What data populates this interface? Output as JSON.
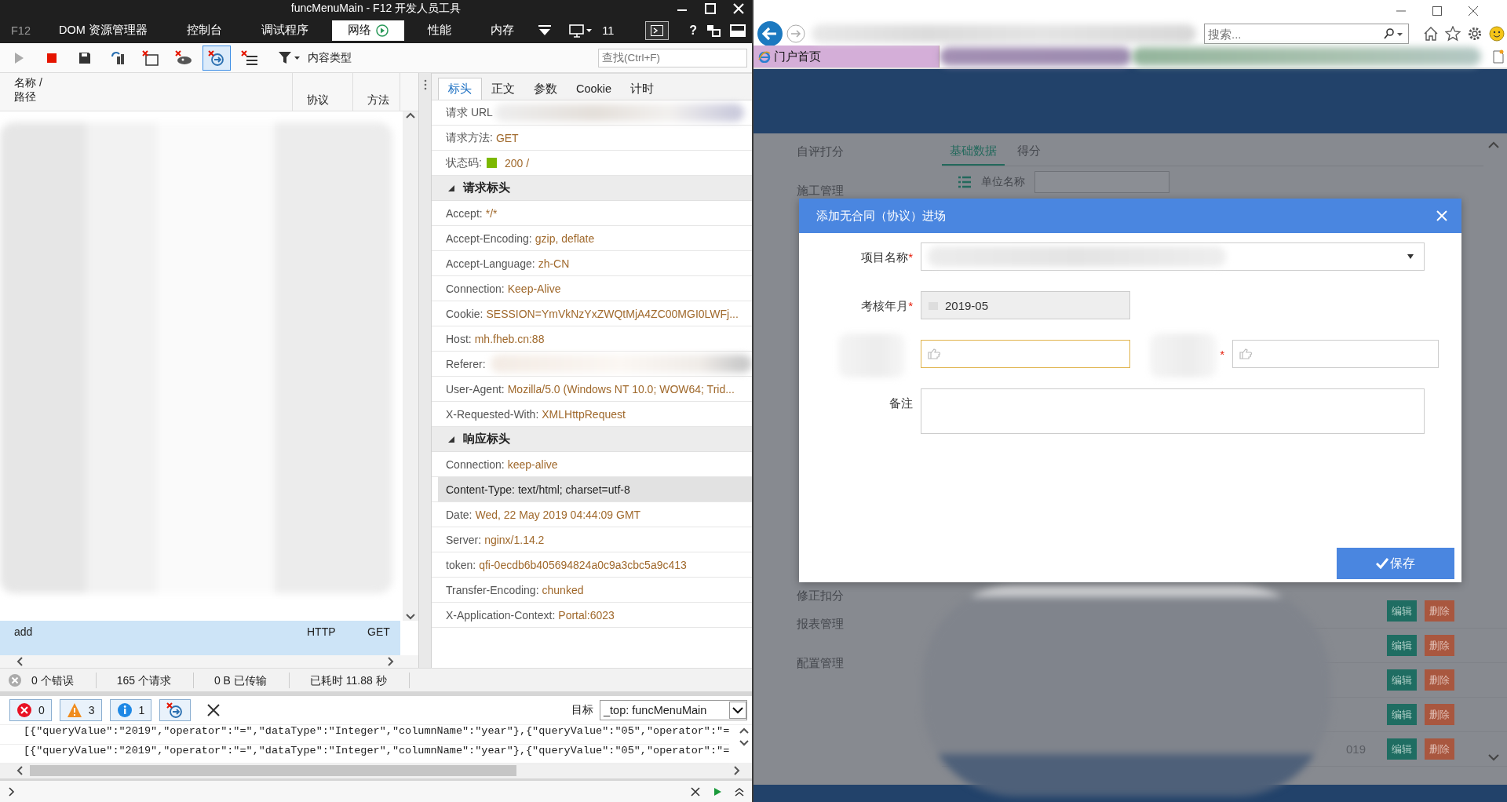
{
  "devtools": {
    "title": "funcMenuMain - F12 开发人员工具",
    "brand": "F12",
    "tabs": [
      {
        "label": "DOM 资源管理器",
        "selected": false
      },
      {
        "label": "控制台",
        "selected": false
      },
      {
        "label": "调试程序",
        "selected": false
      },
      {
        "label": "网络",
        "selected": true
      },
      {
        "label": "性能",
        "selected": false
      },
      {
        "label": "内存",
        "selected": false
      }
    ],
    "document_mode": "11",
    "help": "?",
    "toolbar": {
      "filter_label": "内容类型",
      "search_placeholder": "查找(Ctrl+F)"
    },
    "request_list": {
      "columns": [
        "名称 /\n路径",
        "协议",
        "方法"
      ],
      "rows": [
        {
          "name": "add",
          "protocol": "HTTP",
          "method": "GET",
          "selected": true
        }
      ]
    },
    "detail_tabs": [
      {
        "label": "标头",
        "selected": true
      },
      {
        "label": "正文",
        "selected": false
      },
      {
        "label": "参数",
        "selected": false
      },
      {
        "label": "Cookie",
        "selected": false
      },
      {
        "label": "计时",
        "selected": false
      }
    ],
    "general": [
      {
        "kind": "text",
        "label": "请求 URL"
      },
      {
        "kind": "text",
        "label": "请求方法:",
        "value": "GET"
      },
      {
        "kind": "status",
        "label": "状态码:",
        "value": "200 /"
      }
    ],
    "sections": [
      {
        "title": "请求标头",
        "expanded": true,
        "headers": [
          {
            "name": "Accept:",
            "value": "*/*",
            "selected": false
          },
          {
            "name": "Accept-Encoding:",
            "value": "gzip, deflate",
            "selected": false
          },
          {
            "name": "Accept-Language:",
            "value": "zh-CN",
            "selected": false
          },
          {
            "name": "Connection:",
            "value": "Keep-Alive",
            "selected": false
          },
          {
            "name": "Cookie:",
            "value": "SESSION=YmVkNzYxZWQtMjA4ZC00MGI0LWFj...",
            "selected": false
          },
          {
            "name": "Host:",
            "value": "mh.fheb.cn:88",
            "selected": false
          },
          {
            "name": "Referer:",
            "selected": false
          },
          {
            "name": "User-Agent:",
            "value": "Mozilla/5.0 (Windows NT 10.0; WOW64; Trid...",
            "selected": false
          },
          {
            "name": "X-Requested-With:",
            "value": "XMLHttpRequest",
            "selected": false
          }
        ]
      },
      {
        "title": "响应标头",
        "expanded": true,
        "headers": [
          {
            "name": "Connection:",
            "value": "keep-alive",
            "selected": false
          },
          {
            "name": "Content-Type:",
            "value": "text/html; charset=utf-8",
            "selected": true
          },
          {
            "name": "Date:",
            "value": "Wed, 22 May 2019 04:44:09 GMT",
            "selected": false
          },
          {
            "name": "Server:",
            "value": "nginx/1.14.2",
            "selected": false
          },
          {
            "name": "token:",
            "value": "qfi-0ecdb6b405694824a0c9a3cbc5a9c413",
            "selected": false
          },
          {
            "name": "Transfer-Encoding:",
            "value": "chunked",
            "selected": false
          },
          {
            "name": "X-Application-Context:",
            "value": "Portal:6023",
            "selected": false
          }
        ]
      }
    ],
    "status_bar": [
      "0 个错误",
      "165 个请求",
      "0 B 已传输",
      "已耗时 11.88 秒"
    ],
    "console": {
      "filters": [
        {
          "kind": "error",
          "count": "0"
        },
        {
          "kind": "warning",
          "count": "3"
        },
        {
          "kind": "info",
          "count": "1"
        }
      ],
      "target_label": "目标",
      "target": "_top: funcMenuMain",
      "lines": [
        "[{\"queryValue\":\"2019\",\"operator\":\"=\",\"dataType\":\"Integer\",\"columnName\":\"year\"},{\"queryValue\":\"05\",\"operator\":\"=",
        "[{\"queryValue\":\"2019\",\"operator\":\"=\",\"dataType\":\"Integer\",\"columnName\":\"year\"},{\"queryValue\":\"05\",\"operator\":\"="
      ]
    }
  },
  "browser": {
    "search_placeholder": "搜索...",
    "tabs": [
      {
        "label": "门户首页"
      }
    ],
    "page": {
      "sidebar": [
        "自评打分",
        "施工管理",
        "修正扣分",
        "报表管理",
        "配置管理"
      ],
      "tabs": [
        {
          "label": "基础数据",
          "selected": true
        },
        {
          "label": "得分",
          "selected": false
        }
      ],
      "unit_label": "单位名称",
      "rows": [
        {
          "edit": "编辑",
          "delete": "删除"
        },
        {
          "edit": "编辑",
          "delete": "删除"
        },
        {
          "edit": "编辑",
          "delete": "删除"
        },
        {
          "edit": "编辑",
          "delete": "删除"
        },
        {
          "column_1": "019",
          "edit": "编辑",
          "delete": "删除"
        }
      ],
      "modal": {
        "title": "添加无合同（协议）进场",
        "rows": [
          [
            {
              "kind": "select",
              "label": "项目名称",
              "required_mark": "*"
            }
          ],
          [
            {
              "kind": "date",
              "label": "考核年月",
              "required_mark": "*",
              "value": "2019-05"
            }
          ],
          [
            {
              "kind": "picker",
              "focused": true
            },
            {
              "kind": "picker",
              "required_mark": "*",
              "focused": false
            }
          ],
          [
            {
              "kind": "textarea",
              "label": "备注"
            }
          ]
        ],
        "save": "保存"
      }
    }
  }
}
